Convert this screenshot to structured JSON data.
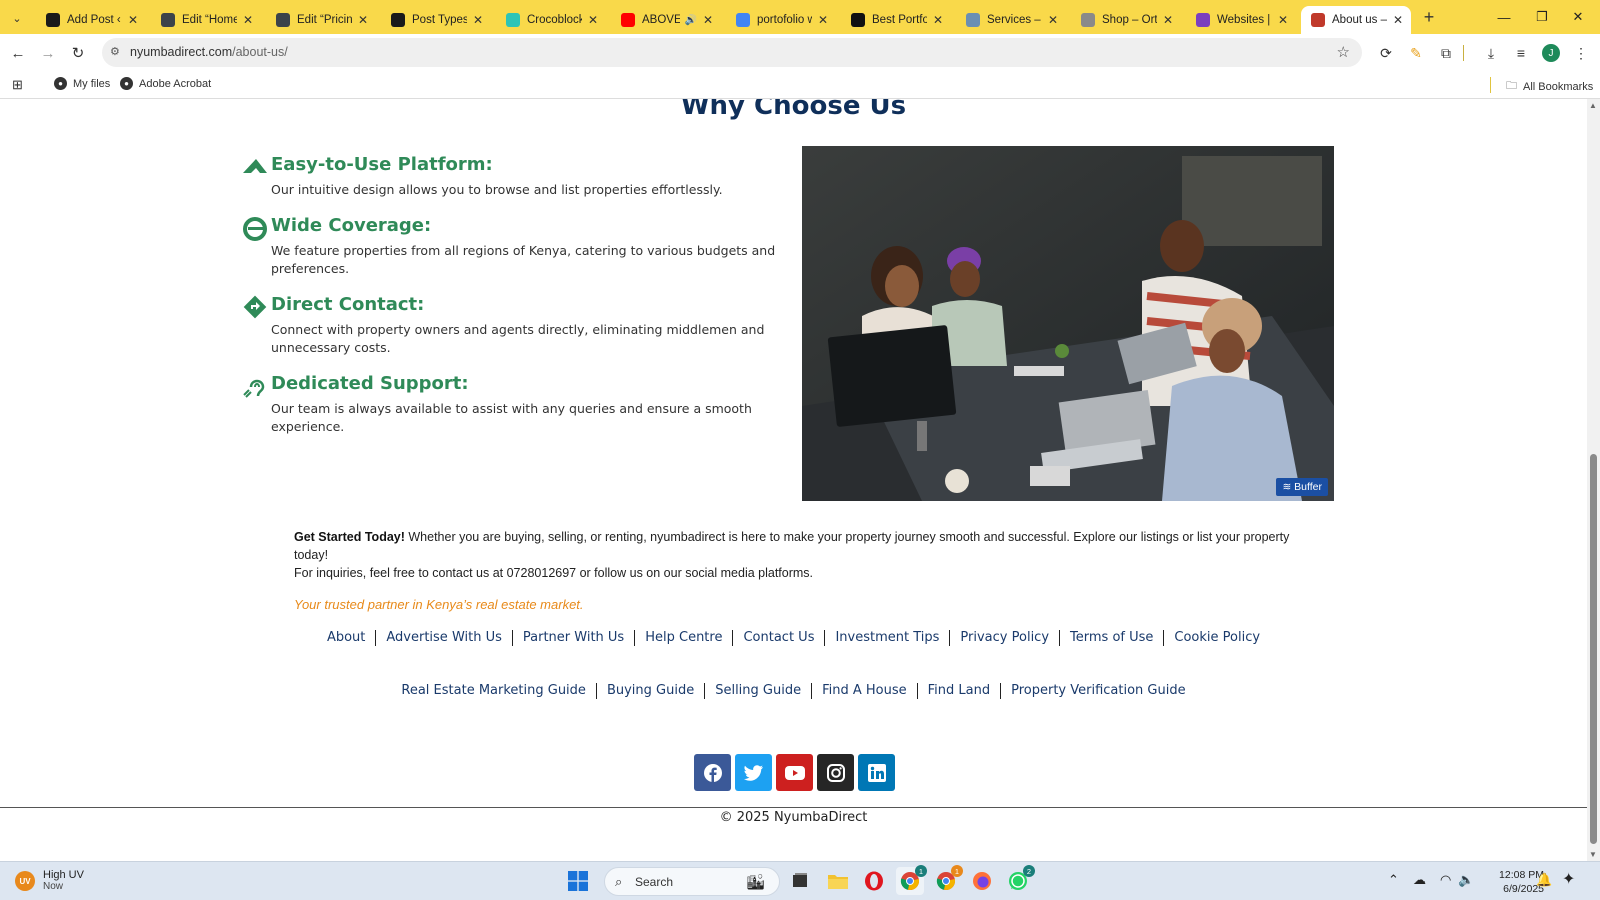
{
  "browser": {
    "tabs": [
      {
        "title": "Add Post ‹ xp",
        "icon": "site-logo-icon",
        "color": "#1a1a1a"
      },
      {
        "title": "Edit “Home”",
        "icon": "wordpress-icon",
        "color": "#3c434a"
      },
      {
        "title": "Edit “Pricing”",
        "icon": "wordpress-icon",
        "color": "#3c434a"
      },
      {
        "title": "Post Types ‹",
        "icon": "site-logo-icon",
        "color": "#1a1a1a"
      },
      {
        "title": "Crocoblock /",
        "icon": "crocoblock-icon",
        "color": "#2ec4b6"
      },
      {
        "title": "ABOVE T",
        "icon": "youtube-icon",
        "color": "#ff0000"
      },
      {
        "title": "portofolio w",
        "icon": "google-icon",
        "color": "#4285f4"
      },
      {
        "title": "Best Portfoli",
        "icon": "w-logo-icon",
        "color": "#111111"
      },
      {
        "title": "Services – m",
        "icon": "services-icon",
        "color": "#6b8fb3"
      },
      {
        "title": "Shop – Orth",
        "icon": "shop-icon",
        "color": "#8a8a8a"
      },
      {
        "title": "Websites | H",
        "icon": "websites-icon",
        "color": "#7b3fbf"
      },
      {
        "title": "About us – N",
        "icon": "about-icon",
        "color": "#c0392b",
        "active": true
      }
    ],
    "url_host": "nyumbadirect.com",
    "url_path": "/about-us/",
    "bookmarks": [
      {
        "label": "My files",
        "icon": "globe-icon"
      },
      {
        "label": "Adobe Acrobat",
        "icon": "acrobat-icon"
      }
    ],
    "all_bookmarks": "All Bookmarks",
    "profile_initial": "J"
  },
  "page": {
    "section_title": "Why Choose Us",
    "features": [
      {
        "title": "Easy-to-Use Platform:",
        "text": "Our intuitive design allows you to browse and list properties effortlessly.",
        "icon": "plane-icon"
      },
      {
        "title": "Wide Coverage:",
        "text": "We feature properties from all regions of Kenya, catering to various budgets and preferences.",
        "icon": "edge-browser-icon"
      },
      {
        "title": "Direct Contact:",
        "text": "Connect with property owners and agents directly, eliminating middlemen and unnecessary costs.",
        "icon": "directions-icon"
      },
      {
        "title": "Dedicated Support:",
        "text": "Our team is always available to assist with any queries and ensure a smooth experience.",
        "icon": "assistive-listening-icon"
      }
    ],
    "buffer_label": "Buffer",
    "intro_bold": "Get Started Today!",
    "intro_text": " Whether you are buying, selling, or renting, nyumbadirect is here to make your property journey smooth and successful. Explore our listings or list your property today!",
    "contact_text": "For inquiries, feel free to contact us at 0728012697 or follow us on our social media platforms.",
    "tagline": "Your trusted partner in Kenya’s real estate market.",
    "footer_links_1": [
      "About",
      "Advertise With Us",
      "Partner With Us",
      "Help Centre",
      "Contact Us",
      "Investment Tips",
      "Privacy Policy",
      "Terms of Use",
      "Cookie Policy"
    ],
    "footer_links_2": [
      "Real Estate Marketing Guide",
      "Buying Guide",
      "Selling Guide",
      "Find A House",
      "Find Land",
      "Property Verification Guide"
    ],
    "social": [
      {
        "name": "facebook-icon",
        "color": "#3b5998"
      },
      {
        "name": "twitter-icon",
        "color": "#1da1f2"
      },
      {
        "name": "youtube-icon",
        "color": "#cd201f"
      },
      {
        "name": "instagram-icon",
        "color": "#262626"
      },
      {
        "name": "linkedin-icon",
        "color": "#0077b5"
      }
    ],
    "copyright": "© 2025 NyumbaDirect"
  },
  "taskbar": {
    "weather_title": "High UV",
    "weather_sub": "Now",
    "uv_label": "UV",
    "search_placeholder": "Search",
    "time": "12:08 PM",
    "date": "6/9/2025",
    "chrome_badge": "1",
    "chrome2_badge": "1",
    "whatsapp_badge": "2"
  },
  "colors": {
    "tabstrip": "#f9d94a",
    "heading": "#0f2f5a",
    "feature_title": "#2f8a58",
    "tagline": "#e88a1a",
    "link": "#1a3a6b"
  }
}
